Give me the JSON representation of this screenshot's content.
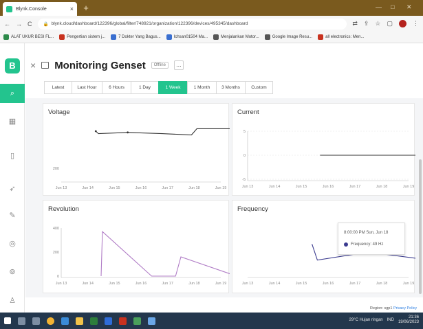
{
  "browser": {
    "tab_title": "Blynk.Console",
    "url": "blynk.cloud/dashboard/122396/global/filter/748921/organization/122396/devices/495345/dashboard",
    "bookmarks": [
      "ALAT UKUR BESI FL...",
      "Pengertian sistem j...",
      "7 Dokter Yang Bagus...",
      "Ichsan01504 Ma...",
      "Menjalankan Motor...",
      "Google Image Resu...",
      "all electronics: Men..."
    ]
  },
  "app": {
    "logo": "B",
    "device_title": "Monitoring Genset",
    "badge": "Offline",
    "more": "..."
  },
  "ranges": [
    {
      "label": "Latest",
      "active": false
    },
    {
      "label": "Last Hour",
      "active": false
    },
    {
      "label": "6 Hours",
      "active": false
    },
    {
      "label": "1 Day",
      "active": false
    },
    {
      "label": "1 Week",
      "active": true
    },
    {
      "label": "1 Month",
      "active": false
    },
    {
      "label": "3 Months",
      "active": false
    },
    {
      "label": "Custom",
      "active": false
    }
  ],
  "charts": {
    "voltage": "Voltage",
    "current": "Current",
    "revolution": "Revolution",
    "frequency": "Frequency"
  },
  "chart_data": [
    {
      "type": "line",
      "title": "Voltage",
      "x": [
        "Jun 13",
        "Jun 14",
        "Jun 15",
        "Jun 16",
        "Jun 17",
        "Jun 18",
        "Jun 19"
      ],
      "y_ticks": [
        200
      ],
      "series": [
        {
          "values": [
            [
              1.3,
              230
            ],
            [
              1.4,
              228
            ],
            [
              2.5,
              229
            ],
            [
              3.8,
              228
            ],
            [
              4.9,
              227
            ],
            [
              5.1,
              232
            ],
            [
              6.4,
              232
            ],
            [
              6.5,
              197
            ]
          ]
        }
      ],
      "color": "#333333"
    },
    {
      "type": "line",
      "title": "Current",
      "x": [
        "Jun 13",
        "Jun 14",
        "Jun 15",
        "Jun 16",
        "Jun 17",
        "Jun 18",
        "Jun 19"
      ],
      "y_ticks": [
        5,
        0,
        -5
      ],
      "series": [
        {
          "values": [
            [
              2.7,
              0
            ],
            [
              6.5,
              0
            ]
          ]
        }
      ],
      "color": "#333333"
    },
    {
      "type": "line",
      "title": "Revolution",
      "x": [
        "Jun 13",
        "Jun 14",
        "Jun 15",
        "Jun 16",
        "Jun 17",
        "Jun 18",
        "Jun 19"
      ],
      "y_ticks": [
        400,
        200,
        0
      ],
      "series": [
        {
          "values": [
            [
              1.5,
              0
            ],
            [
              1.55,
              370
            ],
            [
              3.4,
              0
            ],
            [
              4.3,
              0
            ],
            [
              4.5,
              160
            ],
            [
              6.6,
              0
            ]
          ]
        }
      ],
      "color": "#b07cc6"
    },
    {
      "type": "line",
      "title": "Frequency",
      "x": [
        "Jun 13",
        "Jun 14",
        "Jun 15",
        "Jun 16",
        "Jun 17",
        "Jun 18",
        "Jun 19"
      ],
      "series": [
        {
          "values": [
            [
              2.4,
              49.6
            ],
            [
              2.6,
              49.0
            ],
            [
              4.5,
              49.3
            ],
            [
              6.8,
              49.0
            ]
          ]
        }
      ],
      "color": "#3b3b8f"
    }
  ],
  "tooltip": {
    "time": "8:00:00 PM Sun, Jun 18",
    "value": "Frequency: 49 Hz"
  },
  "footer": {
    "region": "Region: sgp1",
    "privacy": "Privacy Policy"
  },
  "taskbar": {
    "weather": "29°C Hujan ringan",
    "lang": "IND",
    "time": "21:36",
    "date": "19/06/2023"
  }
}
